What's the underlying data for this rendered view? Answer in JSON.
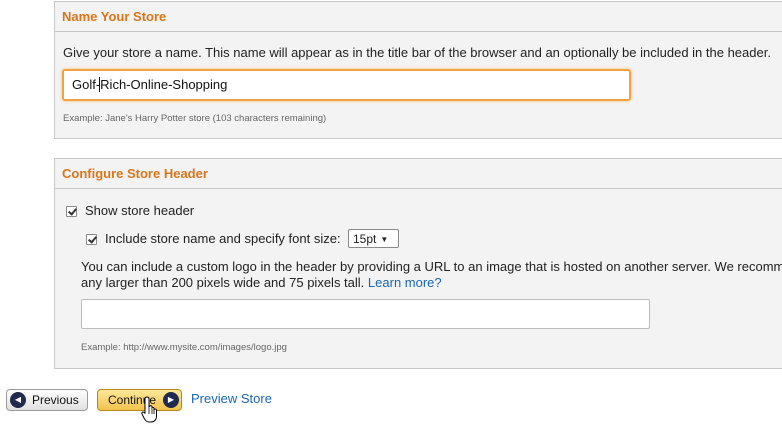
{
  "name_section": {
    "title": "Name Your Store",
    "description": "Give your store a name. This name will appear as in the title bar of the browser and an optionally be included in the header.",
    "input_value_before_caret": "Golf-",
    "input_value_after_caret": "Rich-Online-Shopping",
    "example": "Example: Jane's Harry Potter store (103 characters remaining)"
  },
  "header_section": {
    "title": "Configure Store Header",
    "show_header_label": "Show store header",
    "show_header_checked": true,
    "include_name_label": "Include store name and specify font size:",
    "include_name_checked": true,
    "font_size_selected": "15pt",
    "logo_desc_line1": "You can include a custom logo in the header by providing a URL to an image that is hosted on another server. We recommend",
    "logo_desc_line2": "any larger than 200 pixels wide and 75 pixels tall.",
    "learn_more": "Learn more?",
    "logo_url_value": "",
    "logo_example": "Example: http://www.mysite.com/images/logo.jpg"
  },
  "footer": {
    "previous_label": "Previous",
    "continue_label": "Continue",
    "preview_label": "Preview Store"
  },
  "icons": {
    "previous": "left-arrow-circle-icon",
    "continue": "right-arrow-circle-icon",
    "cursor": "hand-pointer-cursor-icon",
    "select": "dropdown-arrow-icon"
  },
  "colors": {
    "section_title": "#d9761c",
    "link": "#1a66b0",
    "focus_border": "#f0a340",
    "continue_button": "#f2c24c"
  }
}
